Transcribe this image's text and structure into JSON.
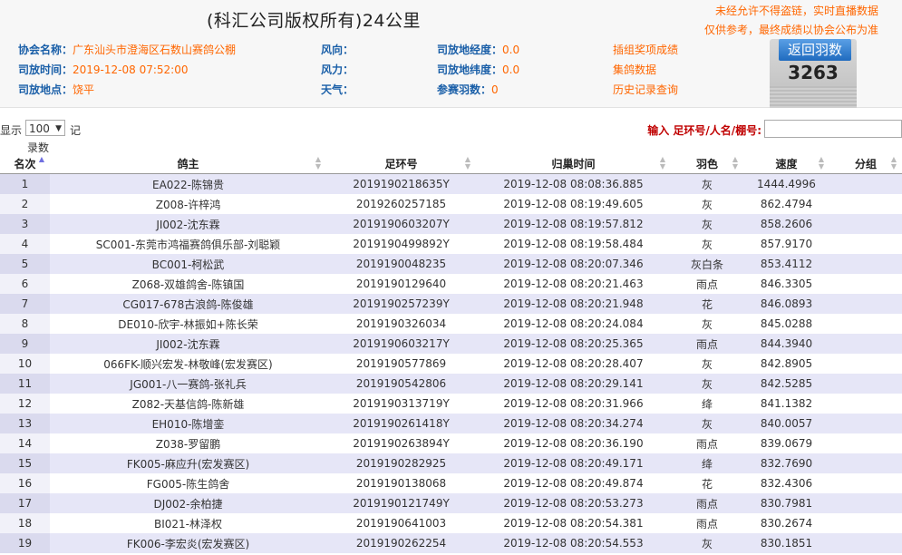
{
  "header": {
    "title": "(科汇公司版权所有)24公里",
    "notice_line1": "未经允许不得盗链，实时直播数据",
    "notice_line2": "仅供参考，最终成绩以协会公布为准"
  },
  "info": {
    "assoc_label": "协会名称：",
    "assoc_value": "广东汕头市澄海区石数山赛鸽公棚",
    "time_label": "司放时间：",
    "time_value": "2019-12-08 07:52:00",
    "place_label": "司放地点：",
    "place_value": "饶平",
    "wind_dir_label": "风向：",
    "wind_dir_value": "",
    "wind_force_label": "风力：",
    "wind_force_value": "",
    "weather_label": "天气：",
    "weather_value": "",
    "lng_label": "司放地经度：",
    "lng_value": "0.0",
    "lat_label": "司放地纬度：",
    "lat_value": "0.0",
    "count_label": "参赛羽数：",
    "count_value": "0"
  },
  "links": {
    "l1": "插组奖项成绩",
    "l2": "集鸽数据",
    "l3": "历史记录查询"
  },
  "badge": {
    "label": "返回羽数",
    "value": "3263"
  },
  "controls": {
    "show_label": "显示",
    "page_size": "100",
    "unit": "记",
    "records_label": "录数",
    "search_label": "输入 足环号/人名/棚号:",
    "search_value": ""
  },
  "table": {
    "headers": [
      "名次",
      "鸽主",
      "足环号",
      "归巢时间",
      "羽色",
      "速度",
      "分组"
    ],
    "rows": [
      [
        "1",
        "EA022-陈锦贵",
        "2019190218635Y",
        "2019-12-08 08:08:36.885",
        "灰",
        "1444.4996",
        ""
      ],
      [
        "2",
        "Z008-许梓鸿",
        "2019260257185",
        "2019-12-08 08:19:49.605",
        "灰",
        "862.4794",
        ""
      ],
      [
        "3",
        "JI002-沈东霖",
        "2019190603207Y",
        "2019-12-08 08:19:57.812",
        "灰",
        "858.2606",
        ""
      ],
      [
        "4",
        "SC001-东莞市鸿福赛鸽俱乐部-刘聪颖",
        "2019190499892Y",
        "2019-12-08 08:19:58.484",
        "灰",
        "857.9170",
        ""
      ],
      [
        "5",
        "BC001-柯松武",
        "2019190048235",
        "2019-12-08 08:20:07.346",
        "灰白条",
        "853.4112",
        ""
      ],
      [
        "6",
        "Z068-双雄鸽舍-陈镇国",
        "2019190129640",
        "2019-12-08 08:20:21.463",
        "雨点",
        "846.3305",
        ""
      ],
      [
        "7",
        "CG017-678古浪鸽-陈俊雄",
        "2019190257239Y",
        "2019-12-08 08:20:21.948",
        "花",
        "846.0893",
        ""
      ],
      [
        "8",
        "DE010-欣宇-林振如+陈长荣",
        "2019190326034",
        "2019-12-08 08:20:24.084",
        "灰",
        "845.0288",
        ""
      ],
      [
        "9",
        "JI002-沈东霖",
        "2019190603217Y",
        "2019-12-08 08:20:25.365",
        "雨点",
        "844.3940",
        ""
      ],
      [
        "10",
        "066FK-顺兴宏发-林敬峰(宏发赛区)",
        "2019190577869",
        "2019-12-08 08:20:28.407",
        "灰",
        "842.8905",
        ""
      ],
      [
        "11",
        "JG001-八一赛鸽-张礼兵",
        "2019190542806",
        "2019-12-08 08:20:29.141",
        "灰",
        "842.5285",
        ""
      ],
      [
        "12",
        "Z082-天基信鸽-陈新雄",
        "2019190313719Y",
        "2019-12-08 08:20:31.966",
        "绛",
        "841.1382",
        ""
      ],
      [
        "13",
        "EH010-陈增銮",
        "2019190261418Y",
        "2019-12-08 08:20:34.274",
        "灰",
        "840.0057",
        ""
      ],
      [
        "14",
        "Z038-罗留鹏",
        "2019190263894Y",
        "2019-12-08 08:20:36.190",
        "雨点",
        "839.0679",
        ""
      ],
      [
        "15",
        "FK005-麻应升(宏发赛区)",
        "2019190282925",
        "2019-12-08 08:20:49.171",
        "绛",
        "832.7690",
        ""
      ],
      [
        "16",
        "FG005-陈生鸽舍",
        "2019190138068",
        "2019-12-08 08:20:49.874",
        "花",
        "832.4306",
        ""
      ],
      [
        "17",
        "DJ002-余柏捷",
        "2019190121749Y",
        "2019-12-08 08:20:53.273",
        "雨点",
        "830.7981",
        ""
      ],
      [
        "18",
        "BI021-林泽权",
        "2019190641003",
        "2019-12-08 08:20:54.381",
        "雨点",
        "830.2674",
        ""
      ],
      [
        "19",
        "FK006-李宏炎(宏发赛区)",
        "2019190262254",
        "2019-12-08 08:20:54.553",
        "灰",
        "830.1851",
        ""
      ]
    ]
  }
}
